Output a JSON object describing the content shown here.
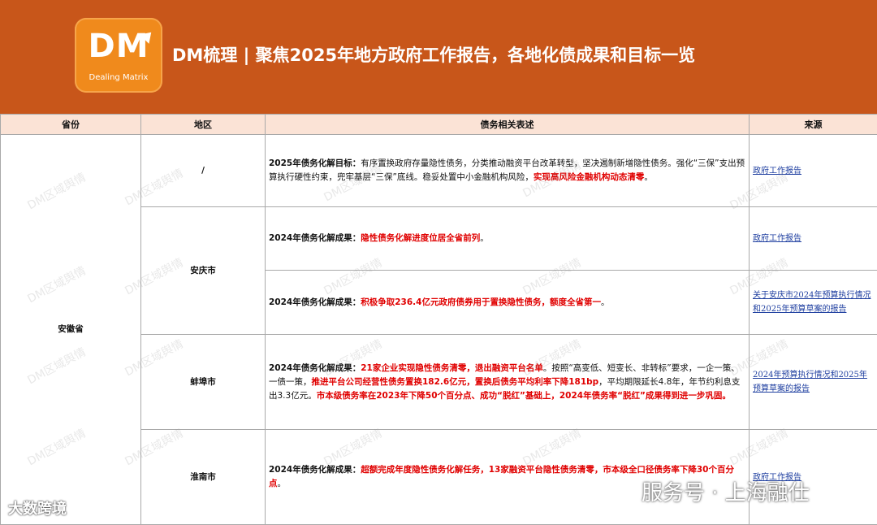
{
  "header": {
    "logo_letters": "DM",
    "logo_sub": "Dealing Matrix",
    "title": "DM梳理 | 聚焦2025年地方政府工作报告，各地化债成果和目标一览"
  },
  "columns": {
    "province": "省份",
    "region": "地区",
    "desc": "债务相关表述",
    "source": "来源"
  },
  "province": "安徽省",
  "rows": [
    {
      "region": "/",
      "label": "2025年债务化解目标：",
      "text": "有序置换政府存量隐性债务，分类推动融资平台改革转型，坚决遏制新增隐性债务。强化“三保”支出预算执行硬性约束，兜牢基层“三保”底线。稳妥处置中小金融机构风险，",
      "red": "实现高风险金融机构动态清零",
      "tail": "。",
      "source": "政府工作报告"
    },
    {
      "region": "安庆市",
      "label": "2024年债务化解成果：",
      "red": "隐性债务化解进度位居全省前列",
      "tail": "。",
      "source": "政府工作报告"
    },
    {
      "label": "2024年债务化解成果：",
      "red": "积极争取236.4亿元政府债券用于置换隐性债务，额度全省第一",
      "tail": "。",
      "source": "关于安庆市2024年预算执行情况和2025年预算草案的报告"
    },
    {
      "region": "蚌埠市",
      "label": "2024年债务化解成果：",
      "red1": "21家企业实现隐性债务清零，退出融资平台名单",
      "text1": "。按照“高变低、短变长、非转标”要求，一企一策、一债一策，",
      "red2": "推进平台公司经营性债务置换182.6亿元，置换后债务平均利率下降181bp",
      "text2": "，平均期限延长4.8年，年节约利息支出3.3亿元。",
      "red3": "市本级债务率在2023年下降50个百分点、成功“脱红”基础上，2024年债务率“脱红”成果得到进一步巩固。",
      "source": "2024年预算执行情况和2025年预算草案的报告"
    },
    {
      "region": "淮南市",
      "label": "2024年债务化解成果：",
      "red": "超额完成年度隐性债务化解任务，13家融资平台隐性债务清零，市本级全口径债务率下降30个百分点",
      "tail": "。",
      "source": "政府工作报告"
    }
  ],
  "watermark_text": "DM区域舆情",
  "overlays": {
    "bottom_left": "大数跨境",
    "bottom_right": "服务号 · 上海融仕"
  },
  "colors": {
    "header_bg": "#c8561a",
    "logo_bg": "#f08a1c",
    "th_bg": "#fbe3d6",
    "highlight_red": "#e00000",
    "link_blue": "#1f3fa0"
  }
}
